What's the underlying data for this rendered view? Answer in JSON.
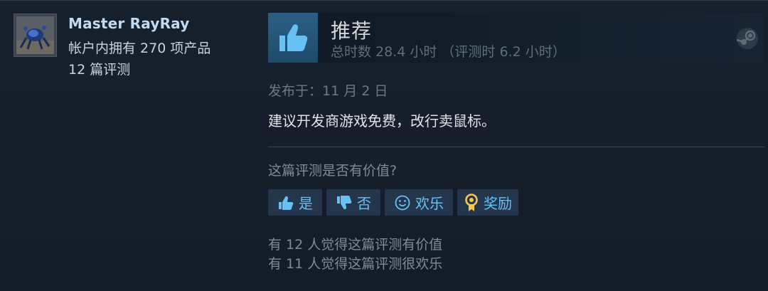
{
  "author": {
    "name": "Master RayRay",
    "products_line": "帐户内拥有 270 项产品",
    "reviews_line": "12 篇评测"
  },
  "review": {
    "verdict": "推荐",
    "hours_text": "总时数 28.4 小时 （评测时 6.2 小时）",
    "posted": "发布于：11 月 2 日",
    "body": "建议开发商游戏免费，改行卖鼠标。"
  },
  "feedback": {
    "question": "这篇评测是否有价值?",
    "buttons": [
      {
        "label": "是",
        "icon": "thumbs-up-icon"
      },
      {
        "label": "否",
        "icon": "thumbs-down-icon"
      },
      {
        "label": "欢乐",
        "icon": "smiley-icon"
      },
      {
        "label": "奖励",
        "icon": "award-icon"
      }
    ],
    "helpful_stat": "有 12 人觉得这篇评测有价值",
    "funny_stat": "有 11 人觉得这篇评测很欢乐"
  },
  "colors": {
    "background": "#1b2838",
    "accent": "#67c1f5",
    "button_bg": "#23364c",
    "thumb_box": "#2c5f86"
  }
}
